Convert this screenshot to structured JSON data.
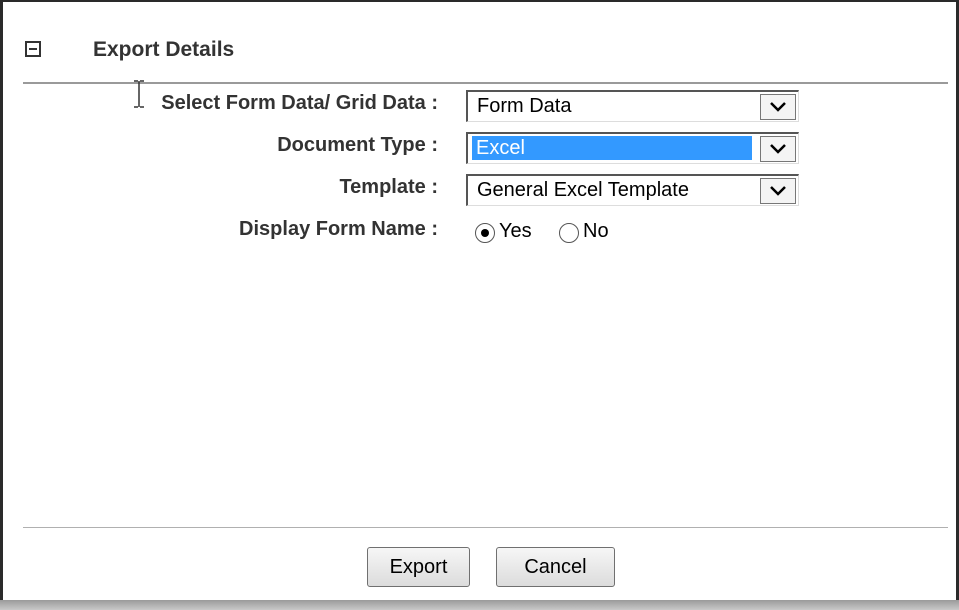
{
  "section": {
    "title": "Export Details"
  },
  "form": {
    "data_source": {
      "label": "Select Form Data/ Grid Data :",
      "value": "Form Data"
    },
    "document_type": {
      "label": "Document Type :",
      "value": "Excel"
    },
    "template": {
      "label": "Template :",
      "value": "General Excel Template"
    },
    "display_form_name": {
      "label": "Display Form Name :",
      "options": [
        "Yes",
        "No"
      ],
      "selected": "Yes"
    }
  },
  "actions": {
    "export_label": "Export",
    "cancel_label": "Cancel"
  },
  "colors": {
    "selection_highlight": "#3399ff",
    "label_text": "#333333"
  }
}
